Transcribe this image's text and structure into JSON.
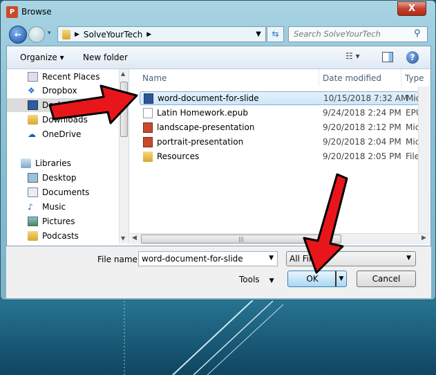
{
  "window": {
    "title": "Browse",
    "close_label": "X"
  },
  "nav": {
    "path": "SolveYourTech",
    "search_placeholder": "Search SolveYourTech"
  },
  "toolbar": {
    "organize": "Organize ▾",
    "new_folder": "New folder"
  },
  "sidebar": {
    "items": [
      {
        "label": "Recent Places",
        "icon": "recent-places-icon"
      },
      {
        "label": "Dropbox",
        "icon": "dropbox-icon"
      },
      {
        "label": "Desktop",
        "icon": "desktop-icon",
        "selected": true
      },
      {
        "label": "Downloads",
        "icon": "folder-icon"
      },
      {
        "label": "OneDrive",
        "icon": "onedrive-icon"
      },
      {
        "label": "Libraries",
        "icon": "libraries-icon"
      },
      {
        "label": "Desktop",
        "icon": "desktop-icon"
      },
      {
        "label": "Documents",
        "icon": "documents-icon"
      },
      {
        "label": "Music",
        "icon": "music-icon"
      },
      {
        "label": "Pictures",
        "icon": "pictures-icon"
      },
      {
        "label": "Podcasts",
        "icon": "folder-icon"
      }
    ]
  },
  "columns": {
    "name": "Name",
    "date": "Date modified",
    "type": "Type"
  },
  "files": [
    {
      "name": "word-document-for-slide",
      "date": "10/15/2018 7:32 AM",
      "type": "Micros",
      "icon": "word",
      "selected": true
    },
    {
      "name": "Latin Homework.epub",
      "date": "9/24/2018 2:24 PM",
      "type": "EPUB F",
      "icon": "blank"
    },
    {
      "name": "landscape-presentation",
      "date": "9/20/2018 2:12 PM",
      "type": "Micros",
      "icon": "ppt"
    },
    {
      "name": "portrait-presentation",
      "date": "9/20/2018 2:04 PM",
      "type": "Micros",
      "icon": "ppt"
    },
    {
      "name": "Resources",
      "date": "9/20/2018 2:05 PM",
      "type": "File fol",
      "icon": "folder"
    }
  ],
  "footer": {
    "file_name_label": "File name:",
    "file_name_value": "word-document-for-slide",
    "filter": "All Files",
    "tools": "Tools",
    "ok": "OK",
    "cancel": "Cancel"
  },
  "colors": {
    "annotation_arrow": "#e8161b",
    "selection": "#cde6f7"
  }
}
